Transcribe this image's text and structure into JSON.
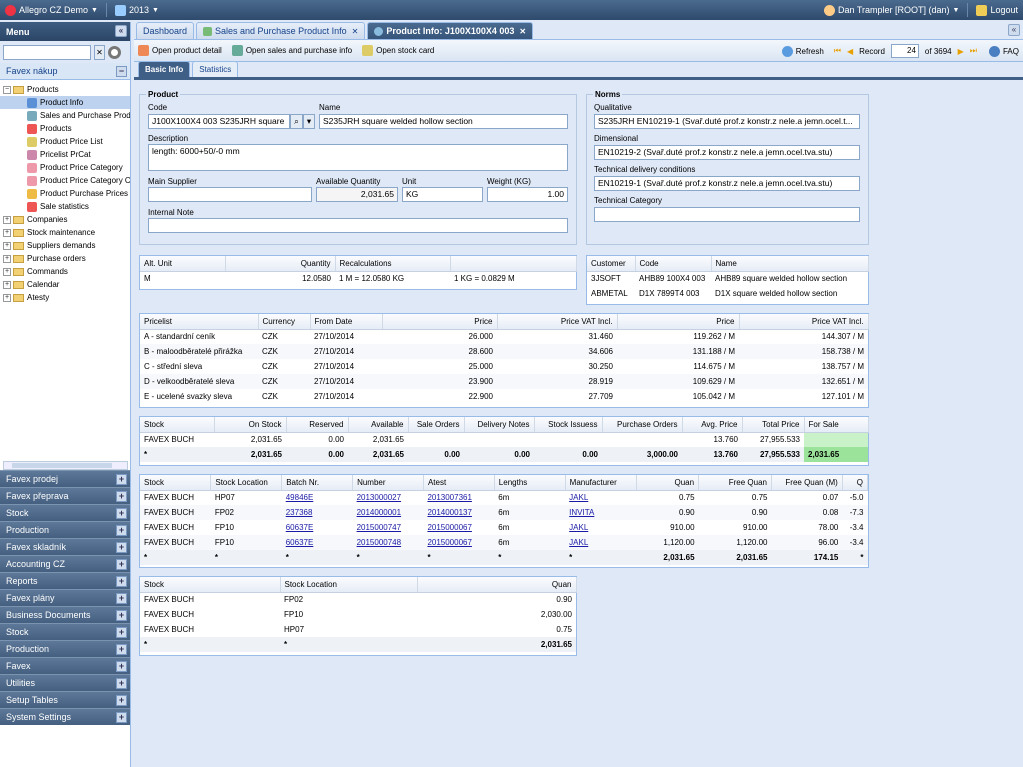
{
  "topbar": {
    "app_title": "Allegro CZ Demo",
    "year": "2013",
    "user": "Dan Trampler [ROOT] (dan)",
    "logout": "Logout"
  },
  "sidebar": {
    "title": "Menu",
    "section": "Favex nákup",
    "tree": [
      {
        "label": "Products",
        "level": 1,
        "expanded": true
      },
      {
        "label": "Product Info",
        "level": 2,
        "selected": true
      },
      {
        "label": "Sales and Purchase Prod",
        "level": 2
      },
      {
        "label": "Products",
        "level": 2
      },
      {
        "label": "Product Price List",
        "level": 2
      },
      {
        "label": "Pricelist PrCat",
        "level": 2
      },
      {
        "label": "Product Price Category",
        "level": 2
      },
      {
        "label": "Product Price Category Ca",
        "level": 2
      },
      {
        "label": "Product Purchase Prices",
        "level": 2
      },
      {
        "label": "Sale statistics",
        "level": 2
      },
      {
        "label": "Companies",
        "level": 1
      },
      {
        "label": "Stock maintenance",
        "level": 1
      },
      {
        "label": "Suppliers demands",
        "level": 1
      },
      {
        "label": "Purchase orders",
        "level": 1
      },
      {
        "label": "Commands",
        "level": 1
      },
      {
        "label": "Calendar",
        "level": 1
      },
      {
        "label": "Atesty",
        "level": 1
      }
    ],
    "accordion": [
      "Favex prodej",
      "Favex přeprava",
      "Stock",
      "Production",
      "Favex skladník",
      "Accounting CZ",
      "Reports",
      "Favex plány",
      "Business Documents",
      "Stock",
      "Production",
      "Favex",
      "Utilities",
      "Setup Tables",
      "System Settings"
    ]
  },
  "tabs": [
    {
      "label": "Dashboard"
    },
    {
      "label": "Sales and Purchase Product Info"
    },
    {
      "label": "Product Info: J100X100X4 003"
    }
  ],
  "toolbar": {
    "open_detail": "Open product detail",
    "open_sales": "Open sales and purchase info",
    "open_stock": "Open stock card",
    "refresh": "Refresh",
    "record_label": "Record",
    "record_value": "24",
    "record_total": "of 3694",
    "faq": "FAQ"
  },
  "subtabs": [
    "Basic Info",
    "Statistics"
  ],
  "product": {
    "legend": "Product",
    "code_label": "Code",
    "code": "J100X100X4 003 S235JRH square",
    "name_label": "Name",
    "name": "S235JRH square welded hollow section",
    "description_label": "Description",
    "description": "length: 6000+50/-0 mm",
    "main_supplier_label": "Main Supplier",
    "main_supplier": "",
    "available_label": "Available Quantity",
    "available": "2,031.65",
    "unit_label": "Unit",
    "unit": "KG",
    "weight_label": "Weight (KG)",
    "weight": "1.00",
    "note_label": "Internal Note",
    "note": ""
  },
  "norms": {
    "legend": "Norms",
    "qualitative_label": "Qualitative",
    "qualitative": "S235JRH EN10219-1 (Svař.duté prof.z konstr.z nele.a jemn.ocel.t...",
    "dimensional_label": "Dimensional",
    "dimensional": "EN10219-2 (Svař.duté prof.z konstr.z nele.a jemn.ocel.tva.stu)",
    "technical_label": "Technical delivery conditions",
    "technical": "EN10219-1 (Svař.duté prof.z konstr.z nele.a jemn.ocel.tva.stu)",
    "category_label": "Technical Category",
    "category": ""
  },
  "alt_unit": {
    "headers": [
      "Alt. Unit",
      "Quantity",
      "Recalculations",
      ""
    ],
    "rows": [
      [
        "M",
        "12.0580",
        "1 M = 12.0580 KG",
        "1 KG = 0.0829 M"
      ]
    ]
  },
  "customers": {
    "headers": [
      "Customer",
      "Code",
      "Name"
    ],
    "rows": [
      [
        "3JSOFT",
        "AHB89 100X4 003",
        "AHB89 square welded hollow section"
      ],
      [
        "ABMETAL",
        "D1X 7899T4 003",
        "D1X square welded hollow section"
      ]
    ]
  },
  "pricelist": {
    "headers": [
      "Pricelist",
      "Currency",
      "From Date",
      "Price",
      "Price VAT Incl.",
      "Price",
      "Price VAT Incl."
    ],
    "rows": [
      [
        "A - standardní ceník",
        "CZK",
        "27/10/2014",
        "26.000",
        "31.460",
        "119.262 / M",
        "144.307 / M"
      ],
      [
        "B - maloodběratelé přirážka",
        "CZK",
        "27/10/2014",
        "28.600",
        "34.606",
        "131.188 / M",
        "158.738 / M"
      ],
      [
        "C - střední sleva",
        "CZK",
        "27/10/2014",
        "25.000",
        "30.250",
        "114.675 / M",
        "138.757 / M"
      ],
      [
        "D - velkoodběratelé sleva",
        "CZK",
        "27/10/2014",
        "23.900",
        "28.919",
        "109.629 / M",
        "132.651 / M"
      ],
      [
        "E - ucelené svazky sleva",
        "CZK",
        "27/10/2014",
        "22.900",
        "27.709",
        "105.042 / M",
        "127.101 / M"
      ]
    ]
  },
  "stock": {
    "headers": [
      "Stock",
      "On Stock",
      "Reserved",
      "Available",
      "Sale Orders",
      "Delivery Notes",
      "Stock Issuess",
      "Purchase Orders",
      "Avg. Price",
      "Total Price",
      "For Sale"
    ],
    "rows": [
      [
        "FAVEX BUCH",
        "2,031.65",
        "0.00",
        "2,031.65",
        "",
        "",
        "",
        "",
        "13.760",
        "27,955.533",
        ""
      ]
    ],
    "sum": [
      "*",
      "2,031.65",
      "0.00",
      "2,031.65",
      "0.00",
      "0.00",
      "0.00",
      "3,000.00",
      "13.760",
      "27,955.533",
      "2,031.65"
    ]
  },
  "batches": {
    "headers": [
      "Stock",
      "Stock Location",
      "Batch Nr.",
      "Number",
      "Atest",
      "Lengths",
      "Manufacturer",
      "Quan",
      "Free Quan",
      "Free Quan (M)",
      "Q"
    ],
    "rows": [
      [
        "FAVEX BUCH",
        "HP07",
        "49846E",
        "2013000027",
        "2013007361",
        "6m",
        "JAKL",
        "0.75",
        "0.75",
        "0.07",
        "-5.0"
      ],
      [
        "FAVEX BUCH",
        "FP02",
        "237368",
        "2014000001",
        "2014000137",
        "6m",
        "INVITA",
        "0.90",
        "0.90",
        "0.08",
        "-7.3"
      ],
      [
        "FAVEX BUCH",
        "FP10",
        "60637E",
        "2015000747",
        "2015000067",
        "6m",
        "JAKL",
        "910.00",
        "910.00",
        "78.00",
        "-3.4"
      ],
      [
        "FAVEX BUCH",
        "FP10",
        "60637E",
        "2015000748",
        "2015000067",
        "6m",
        "JAKL",
        "1,120.00",
        "1,120.00",
        "96.00",
        "-3.4"
      ]
    ],
    "sum": [
      "*",
      "*",
      "*",
      "*",
      "*",
      "*",
      "*",
      "2,031.65",
      "2,031.65",
      "174.15",
      "*"
    ]
  },
  "locations": {
    "headers": [
      "Stock",
      "Stock Location",
      "Quan"
    ],
    "rows": [
      [
        "FAVEX BUCH",
        "FP02",
        "0.90"
      ],
      [
        "FAVEX BUCH",
        "FP10",
        "2,030.00"
      ],
      [
        "FAVEX BUCH",
        "HP07",
        "0.75"
      ]
    ],
    "sum": [
      "*",
      "*",
      "2,031.65"
    ]
  }
}
